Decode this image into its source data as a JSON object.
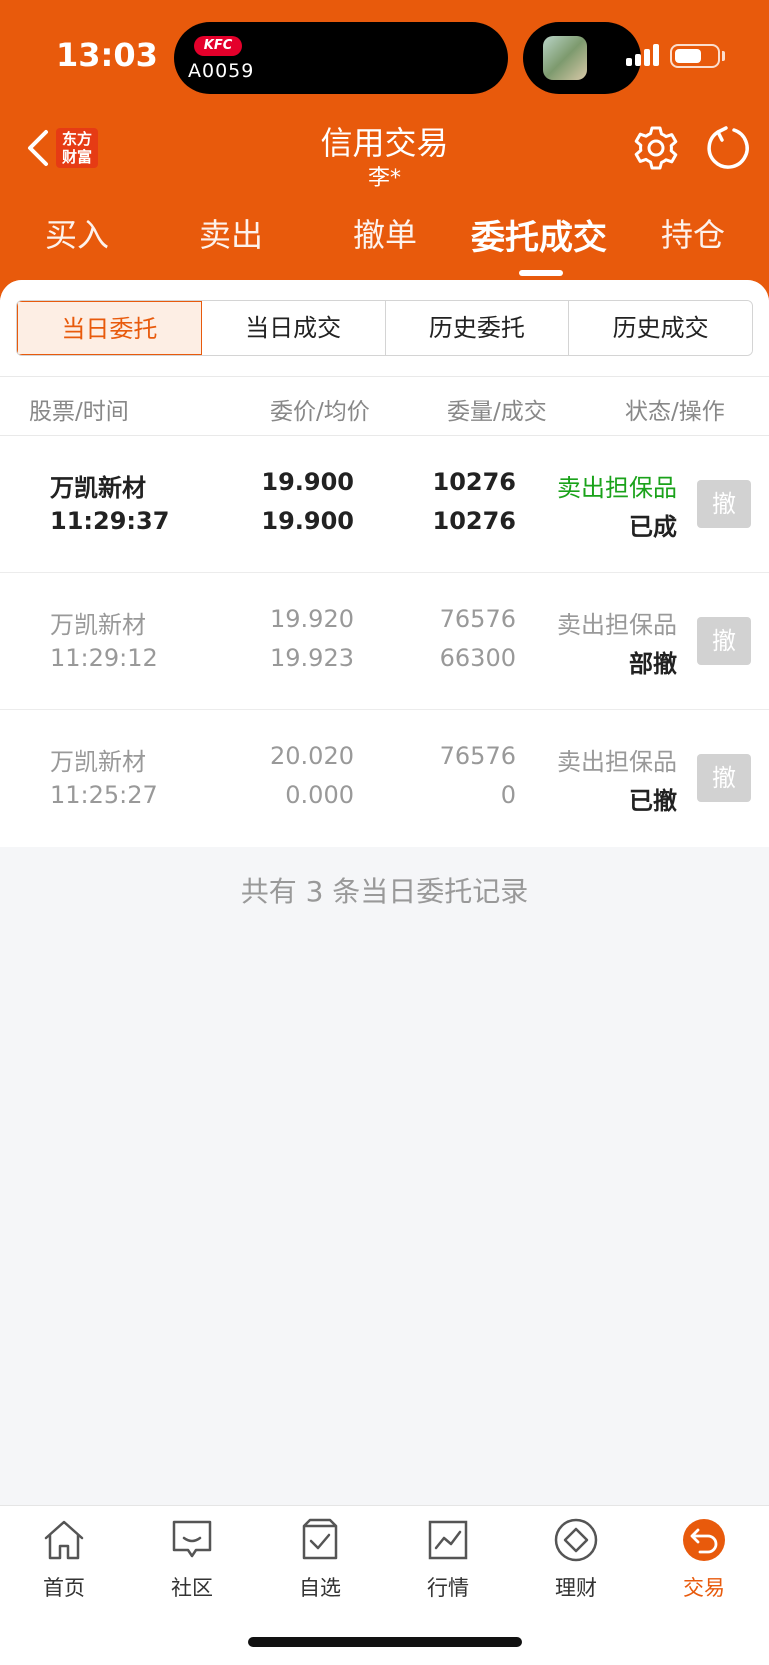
{
  "status_bar": {
    "time": "13:03",
    "live_activity_brand": "KFC",
    "live_activity_code": "A0059"
  },
  "header": {
    "brand_line1": "东方",
    "brand_line2": "财富",
    "title": "信用交易",
    "subtitle": "李*"
  },
  "main_tabs": [
    {
      "label": "买入"
    },
    {
      "label": "卖出"
    },
    {
      "label": "撤单"
    },
    {
      "label": "委托成交",
      "active": true
    },
    {
      "label": "持仓"
    }
  ],
  "sub_tabs": [
    {
      "label": "当日委托",
      "active": true
    },
    {
      "label": "当日成交"
    },
    {
      "label": "历史委托"
    },
    {
      "label": "历史成交"
    }
  ],
  "table": {
    "headers": {
      "stock_time": "股票/时间",
      "price": "委价/均价",
      "qty": "委量/成交",
      "status": "状态/操作"
    },
    "rows": [
      {
        "name": "万凯新材",
        "time": "11:29:37",
        "order_price": "19.900",
        "avg_price": "19.900",
        "order_qty": "10276",
        "filled_qty": "10276",
        "type": "卖出担保品",
        "status": "已成",
        "action": "撤"
      },
      {
        "name": "万凯新材",
        "time": "11:29:12",
        "order_price": "19.920",
        "avg_price": "19.923",
        "order_qty": "76576",
        "filled_qty": "66300",
        "type": "卖出担保品",
        "status": "部撤",
        "action": "撤"
      },
      {
        "name": "万凯新材",
        "time": "11:25:27",
        "order_price": "20.020",
        "avg_price": "0.000",
        "order_qty": "76576",
        "filled_qty": "0",
        "type": "卖出担保品",
        "status": "已撤",
        "action": "撤"
      }
    ],
    "footer": "共有 3 条当日委托记录"
  },
  "bottom_nav": [
    {
      "label": "首页",
      "icon": "home-icon"
    },
    {
      "label": "社区",
      "icon": "community-icon"
    },
    {
      "label": "自选",
      "icon": "watchlist-icon"
    },
    {
      "label": "行情",
      "icon": "market-icon"
    },
    {
      "label": "理财",
      "icon": "wealth-icon"
    },
    {
      "label": "交易",
      "icon": "trade-icon",
      "active": true
    }
  ],
  "colors": {
    "brand": "#e85a0c",
    "buy_green": "#1aa21a",
    "bg": "#f5f6f8"
  }
}
